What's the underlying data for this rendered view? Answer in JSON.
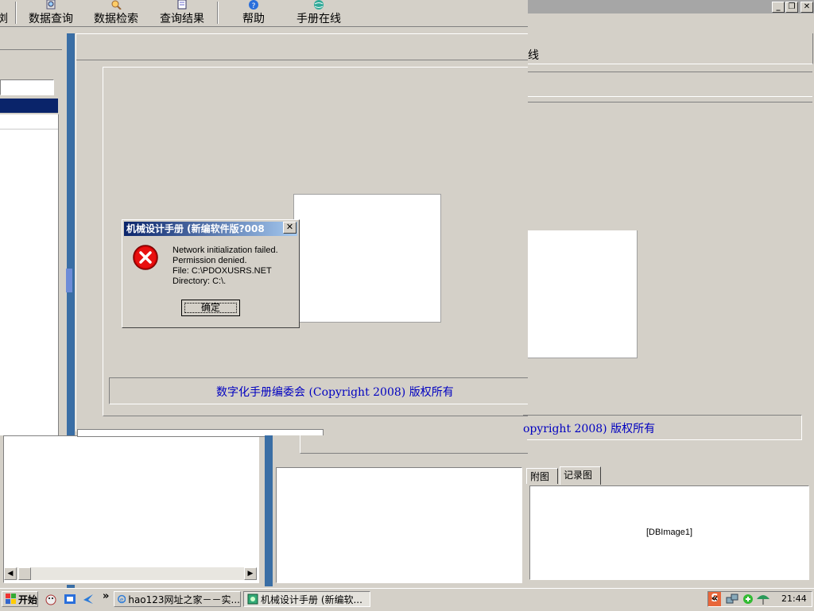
{
  "toolbar": {
    "items": [
      {
        "label": "浏"
      },
      {
        "label": "数据查询"
      },
      {
        "label": "数据检索"
      },
      {
        "label": "查询结果"
      },
      {
        "label": "帮助"
      },
      {
        "label": "手册在线"
      }
    ]
  },
  "window": {
    "caption_buttons": {
      "minimize": "_",
      "restore": "❐",
      "close": "✕"
    }
  },
  "main": {
    "header_fragment": "线",
    "copyright_text": "数字化手册编委会 (Copyright 2008) 版权所有",
    "copyright_fragment": "opyright 2008) 版权所有",
    "tabs": [
      "附图",
      "记录图"
    ],
    "active_tab": "记录图",
    "image_placeholder": "[DBImage1]"
  },
  "dialog": {
    "title": "机械设计手册 (新编软件版?008",
    "close_label": "✕",
    "icon": "error-icon",
    "message_lines": [
      "Network initialization failed.",
      "Permission denied.",
      "File: C:\\PDOXUSRS.NET",
      "Directory: C:\\."
    ],
    "ok_label": "确定"
  },
  "taskbar": {
    "start_label": "开始",
    "tasks": [
      {
        "label": "hao123网址之家－－实..."
      },
      {
        "label": "机械设计手册 (新编软..."
      }
    ],
    "chevron": "»",
    "tray_chevron": "«",
    "clock": "21:44"
  }
}
